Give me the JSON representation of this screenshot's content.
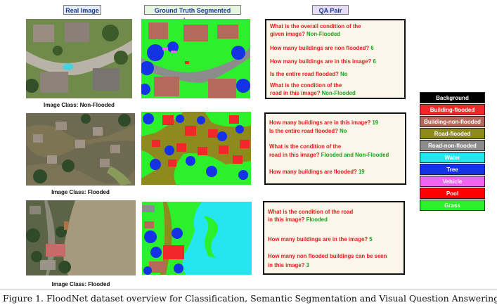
{
  "headers": {
    "real_image": "Real Image",
    "ground_truth": "Ground Truth Segmented Image",
    "qa_pair": "QA Pair"
  },
  "rows": [
    {
      "caption": "Image Class: Non-Flooded",
      "qa": [
        {
          "q": "What is the overall condition of the",
          "a": ""
        },
        {
          "q": "given image?",
          "a": "Non-Flooded"
        },
        {
          "q": "How many buildings are non flooded?",
          "a": "6"
        },
        {
          "q": "How many buildings are in this image?",
          "a": "6"
        },
        {
          "q": "Is the entire road flooded?",
          "a": "No"
        },
        {
          "q": "What is the condition of the",
          "a": ""
        },
        {
          "q": "road in this image?",
          "a": "Non-Flooded"
        }
      ]
    },
    {
      "caption": "Image Class: Flooded",
      "qa": [
        {
          "q": "How many buildings are in this image?",
          "a": "19"
        },
        {
          "q": "Is the entire road flooded?",
          "a": "No"
        },
        {
          "q": "What is the condition of the",
          "a": ""
        },
        {
          "q": "road in this image?",
          "a": "Flooded and Non-Flooded"
        },
        {
          "q": "How many buildings are flooded?",
          "a": "19"
        }
      ]
    },
    {
      "caption": "Image Class: Flooded",
      "qa": [
        {
          "q": "What is the condition of the road",
          "a": ""
        },
        {
          "q": "in this image?",
          "a": "Flooded"
        },
        {
          "q": "How many buildings are in the image?",
          "a": "5"
        },
        {
          "q": "How many non flooded buildings can be seen",
          "a": ""
        },
        {
          "q": "in this image?",
          "a": "3"
        }
      ]
    }
  ],
  "legend": [
    {
      "label": "Background",
      "color": "#000000",
      "text_color": "#ffffff"
    },
    {
      "label": "Building-flooded",
      "color": "#f0282a",
      "text_color": "#ffffff"
    },
    {
      "label": "Building-non-flooded",
      "color": "#b4695a",
      "text_color": "#ffffff"
    },
    {
      "label": "Road-flooded",
      "color": "#8f8a1e",
      "text_color": "#ffffff"
    },
    {
      "label": "Road-non-flooded",
      "color": "#8c8c8c",
      "text_color": "#ffffff"
    },
    {
      "label": "Water",
      "color": "#23e6f0",
      "text_color": "#ffffff"
    },
    {
      "label": "Tree",
      "color": "#1432e6",
      "text_color": "#ffffff"
    },
    {
      "label": "Vehicle",
      "color": "#f064f0",
      "text_color": "#ffffff"
    },
    {
      "label": "Pool",
      "color": "#ff0000",
      "text_color": "#ffffff"
    },
    {
      "label": "Grass",
      "color": "#2df02d",
      "text_color": "#ffffff"
    }
  ],
  "header_colors": {
    "real_image": "#e6eefa",
    "ground_truth": "#e6f5e0",
    "qa_pair": "#e6dcf5"
  },
  "figure_caption": "Figure 1. FloodNet dataset overview for Classification, Semantic Segmentation and Visual Question Answering"
}
